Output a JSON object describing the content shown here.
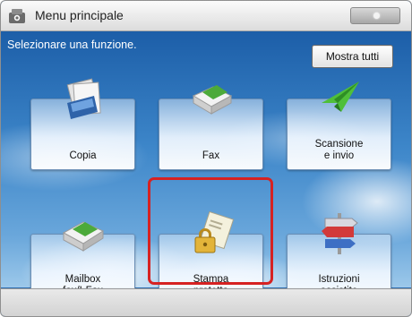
{
  "header": {
    "title": "Menu principale",
    "home_icon": "home-icon",
    "status_button_icon": "status-dot-icon"
  },
  "main": {
    "instruction": "Selezionare una funzione.",
    "show_all_label": "Mostra tutti",
    "tiles": [
      {
        "lines": [
          "Copia"
        ],
        "icon": "copy-icon"
      },
      {
        "lines": [
          "Fax"
        ],
        "icon": "fax-icon"
      },
      {
        "lines": [
          "Scansione",
          "e invio"
        ],
        "icon": "scan-send-icon"
      },
      {
        "lines": [
          "Mailbox",
          "fax/I-Fax"
        ],
        "icon": "mailbox-fax-icon"
      },
      {
        "lines": [
          "Stampa",
          "protetta"
        ],
        "icon": "secure-print-icon",
        "highlighted": true
      },
      {
        "lines": [
          "Istruzioni",
          "assistite"
        ],
        "icon": "guide-signpost-icon"
      }
    ]
  },
  "colors": {
    "highlight": "#d62222",
    "sky_top": "#1c5ea8",
    "sky_bottom": "#9cc8ea"
  }
}
